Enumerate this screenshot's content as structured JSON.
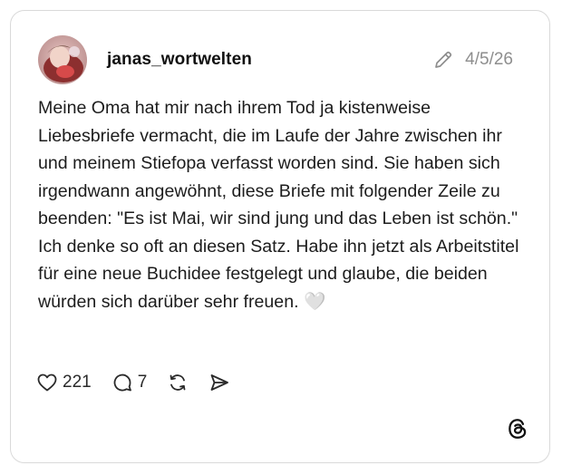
{
  "post": {
    "username": "janas_wortwelten",
    "date": "4/5/26",
    "text": "Meine Oma hat mir nach ihrem Tod ja kistenweise Liebesbriefe vermacht, die im Laufe der Jahre zwischen ihr und meinem Stiefopa verfasst worden sind. Sie haben sich irgendwann angewöhnt, diese Briefe mit folgender Zeile zu beenden: \"Es ist Mai, wir sind jung und das Leben ist schön.\" Ich denke so oft an diesen Satz. Habe ihn jetzt als Arbeitstitel für eine neue Buchidee festgelegt und glaube, die beiden würden sich darüber sehr freuen. 🤍"
  },
  "actions": {
    "likes": "221",
    "replies": "7"
  },
  "icons": {
    "edit": "pencil-icon",
    "like": "heart-icon",
    "reply": "comment-icon",
    "repost": "repost-icon",
    "share": "send-icon",
    "brand": "threads-logo-icon"
  }
}
